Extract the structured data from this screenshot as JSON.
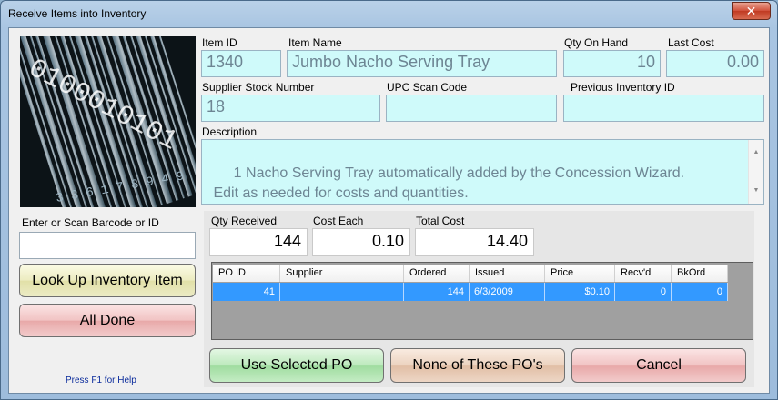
{
  "window": {
    "title": "Receive Items into Inventory",
    "close_label": "✕"
  },
  "barcode_image": {
    "text": "0100010101",
    "numbers": "3 3 6 1 7 8 9 4 9"
  },
  "item": {
    "id_label": "Item ID",
    "id_value": "1340",
    "name_label": "Item Name",
    "name_value": "Jumbo Nacho Serving Tray",
    "qty_on_hand_label": "Qty On Hand",
    "qty_on_hand_value": "10",
    "last_cost_label": "Last Cost",
    "last_cost_value": "0.00",
    "supplier_stock_label": "Supplier Stock Number",
    "supplier_stock_value": "18",
    "upc_label": "UPC Scan Code",
    "upc_value": "",
    "prev_inv_label": "Previous Inventory ID",
    "prev_inv_value": "",
    "description_label": "Description",
    "description_value": "1 Nacho Serving Tray automatically added by the Concession Wizard.\n Edit as needed for costs and quantities."
  },
  "scan": {
    "label": "Enter or Scan Barcode or ID",
    "value": ""
  },
  "buttons": {
    "lookup": "Look Up Inventory Item",
    "all_done": "All Done",
    "use_selected_po": "Use Selected PO",
    "none_of_these": "None of These PO's",
    "cancel": "Cancel"
  },
  "help_text": "Press F1 for Help",
  "receive": {
    "qty_label": "Qty Received",
    "qty_value": "144",
    "cost_label": "Cost Each",
    "cost_value": "0.10",
    "total_label": "Total Cost",
    "total_value": "14.40"
  },
  "po_grid": {
    "columns": [
      "PO ID",
      "Supplier",
      "Ordered",
      "Issued",
      "Price",
      "Recv'd",
      "BkOrd"
    ],
    "rows": [
      {
        "po_id": "41",
        "supplier": "",
        "ordered": "144",
        "issued": "6/3/2009",
        "price": "$0.10",
        "recvd": "0",
        "bkord": "0"
      }
    ]
  },
  "colors": {
    "field_bg": "#cffafa",
    "selected_row": "#3399ff",
    "help_text": "#0a2b9c"
  }
}
